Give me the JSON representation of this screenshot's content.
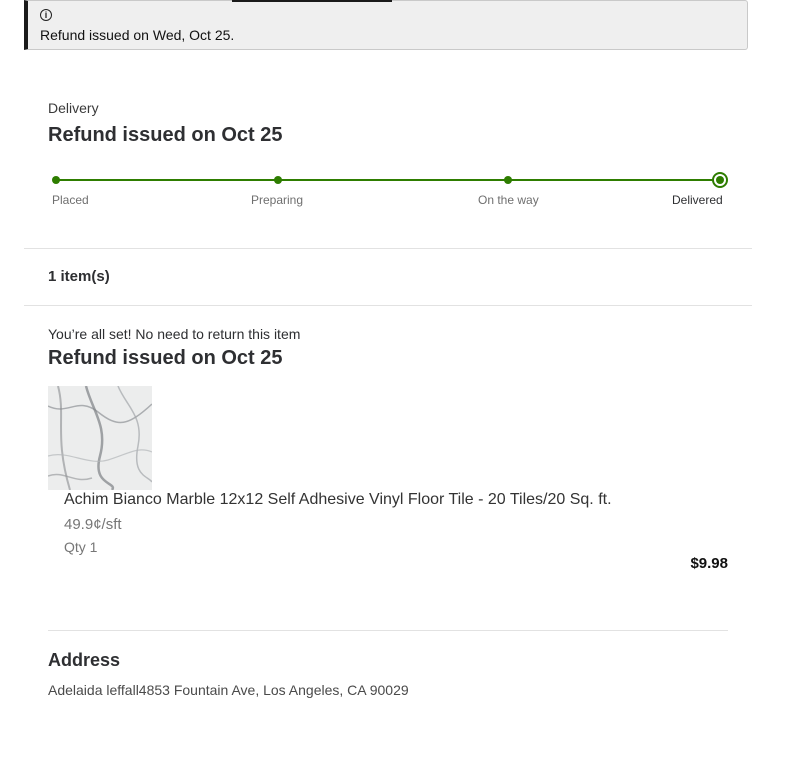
{
  "alert": {
    "icon": "info-icon",
    "icon_glyph": "i",
    "message": "Refund issued on Wed, Oct 25."
  },
  "delivery": {
    "eyebrow": "Delivery",
    "headline": "Refund issued on Oct 25",
    "steps": [
      {
        "label": "Placed",
        "status": "complete"
      },
      {
        "label": "Preparing",
        "status": "complete"
      },
      {
        "label": "On the way",
        "status": "complete"
      },
      {
        "label": "Delivered",
        "status": "current"
      }
    ],
    "progress_percent": 100,
    "accent_color": "#2e7d00"
  },
  "items": {
    "count_label": "1 item(s)",
    "note": "You’re all set! No need to return this item",
    "headline": "Refund issued on Oct 25",
    "list": [
      {
        "image": "marble-tile-thumbnail",
        "name": "Achim Bianco Marble 12x12 Self Adhesive Vinyl Floor Tile - 20 Tiles/20 Sq. ft.",
        "unit_price": "49.9¢/sft",
        "qty": "Qty 1",
        "price": "$9.98"
      }
    ]
  },
  "address": {
    "title": "Address",
    "text": "Adelaida leffall4853 Fountain Ave, Los Angeles, CA 90029"
  }
}
